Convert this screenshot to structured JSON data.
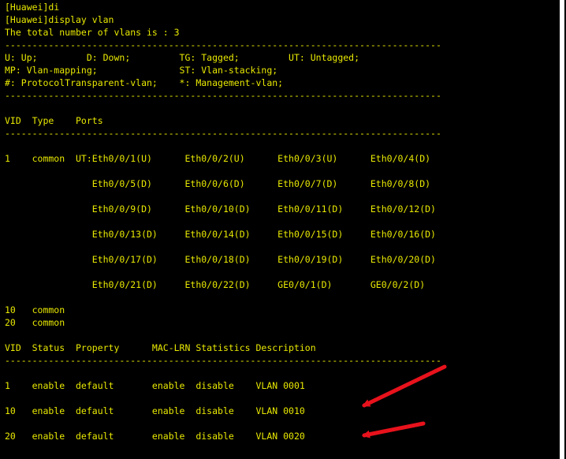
{
  "terminal": {
    "lines": [
      "[Huawei]di",
      "[Huawei]display vlan",
      "The total number of vlans is : 3",
      "--------------------------------------------------------------------------------",
      "U: Up;         D: Down;         TG: Tagged;         UT: Untagged;",
      "MP: Vlan-mapping;               ST: Vlan-stacking;",
      "#: ProtocolTransparent-vlan;    *: Management-vlan;",
      "--------------------------------------------------------------------------------",
      "",
      "VID  Type    Ports",
      "--------------------------------------------------------------------------------",
      "",
      "1    common  UT:Eth0/0/1(U)      Eth0/0/2(U)      Eth0/0/3(U)      Eth0/0/4(D)",
      "",
      "                Eth0/0/5(D)      Eth0/0/6(D)      Eth0/0/7(D)      Eth0/0/8(D)",
      "",
      "                Eth0/0/9(D)      Eth0/0/10(D)     Eth0/0/11(D)     Eth0/0/12(D)",
      "",
      "                Eth0/0/13(D)     Eth0/0/14(D)     Eth0/0/15(D)     Eth0/0/16(D)",
      "",
      "                Eth0/0/17(D)     Eth0/0/18(D)     Eth0/0/19(D)     Eth0/0/20(D)",
      "",
      "                Eth0/0/21(D)     Eth0/0/22(D)     GE0/0/1(D)       GE0/0/2(D)",
      "",
      "10   common",
      "20   common",
      "",
      "VID  Status  Property      MAC-LRN Statistics Description",
      "--------------------------------------------------------------------------------",
      "",
      "1    enable  default       enable  disable    VLAN 0001",
      "",
      "10   enable  default       enable  disable    VLAN 0010",
      "",
      "20   enable  default       enable  disable    VLAN 0020"
    ]
  },
  "annotations": {
    "arrow_color": "#e8121c"
  }
}
